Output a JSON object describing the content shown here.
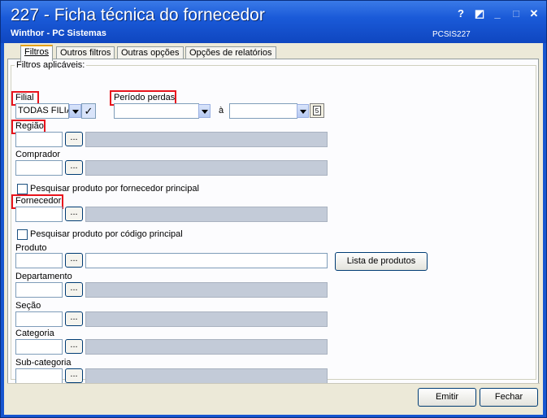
{
  "window": {
    "title": "227 - Ficha técnica do fornecedor",
    "subtitle": "Winthor - PC Sistemas",
    "program_code": "PCSIS227",
    "controls": {
      "help": "?",
      "context": "◩",
      "minimize": "_",
      "maximize": "□",
      "close": "✕"
    }
  },
  "tabs": [
    {
      "label": "Filtros",
      "active": true
    },
    {
      "label": "Outros filtros"
    },
    {
      "label": "Outras opções"
    },
    {
      "label": "Opções de relatórios"
    }
  ],
  "group": {
    "label": "Filtros aplicáveis:"
  },
  "filial": {
    "label": "Filial",
    "value": "TODAS FILIAIS"
  },
  "periodo": {
    "label": "Período perdas",
    "separator": "à",
    "start": "",
    "end": ""
  },
  "regiao": {
    "label": "Região",
    "code": "",
    "desc": ""
  },
  "comprador": {
    "label": "Comprador",
    "code": "",
    "desc": ""
  },
  "chk_fornecedor_principal": {
    "label": "Pesquisar produto por fornecedor principal",
    "checked": false
  },
  "fornecedor": {
    "label": "Fornecedor",
    "code": "",
    "desc": ""
  },
  "chk_codigo_principal": {
    "label": "Pesquisar produto por código principal",
    "checked": false
  },
  "produto": {
    "label": "Produto",
    "code": "",
    "desc": "",
    "list_button": "Lista de produtos"
  },
  "departamento": {
    "label": "Departamento",
    "code": "",
    "desc": ""
  },
  "secao": {
    "label": "Seção",
    "code": "",
    "desc": ""
  },
  "categoria": {
    "label": "Categoria",
    "code": "",
    "desc": ""
  },
  "subcategoria": {
    "label": "Sub-categoria",
    "code": "",
    "desc": ""
  },
  "lookup_button": "...",
  "footer": {
    "emit": "Emitir",
    "close": "Fechar"
  },
  "colors": {
    "highlight": "#e8141d",
    "title_bar": "#1655d0",
    "disabled_field": "#c3cbd8"
  }
}
